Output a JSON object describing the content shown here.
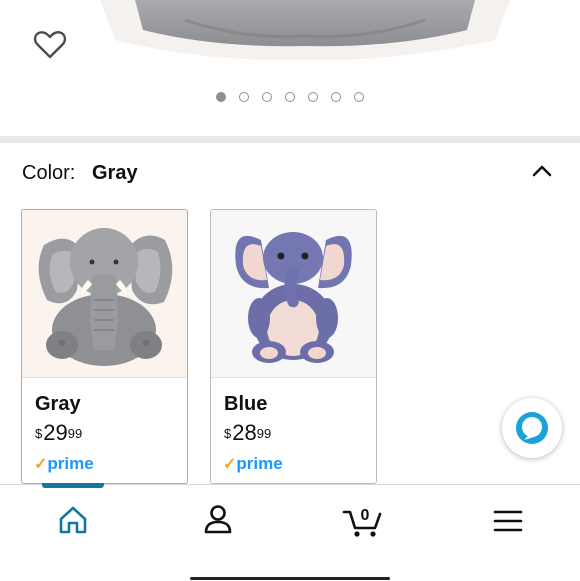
{
  "carousel": {
    "page_count": 7,
    "active_index": 0
  },
  "variation": {
    "label": "Color:",
    "selected_value": "Gray",
    "options": [
      {
        "name": "Gray",
        "currency": "$",
        "price_whole": "29",
        "price_fraction": "99",
        "prime": "prime",
        "selected": true
      },
      {
        "name": "Blue",
        "currency": "$",
        "price_whole": "28",
        "price_fraction": "99",
        "prime": "prime",
        "selected": false
      }
    ]
  },
  "bottom_nav": {
    "active": "home",
    "items": [
      "home-icon",
      "account-icon",
      "cart-icon",
      "menu-icon"
    ],
    "cart_count": "0"
  },
  "colors": {
    "accent": "#12799e",
    "prime_blue": "#1a98ff",
    "prime_check": "#f6a12e",
    "selected_border": "#e8a33e"
  }
}
